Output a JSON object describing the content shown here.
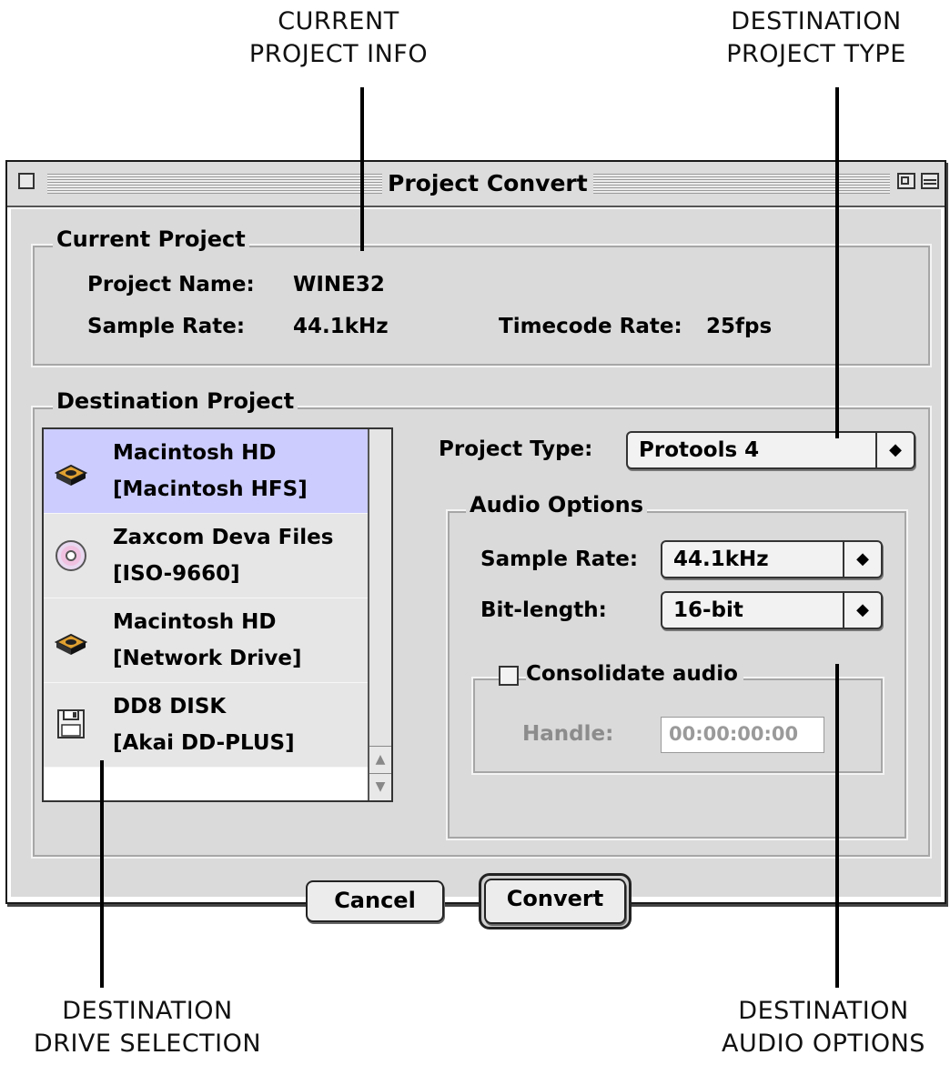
{
  "callouts": {
    "current_project_info": [
      "CURRENT",
      "PROJECT INFO"
    ],
    "destination_project_type": [
      "DESTINATION",
      "PROJECT TYPE"
    ],
    "destination_drive_selection": [
      "DESTINATION",
      "DRIVE SELECTION"
    ],
    "destination_audio_options": [
      "DESTINATION",
      "AUDIO OPTIONS"
    ]
  },
  "window": {
    "title": "Project Convert"
  },
  "current_project": {
    "group_title": "Current Project",
    "project_name_label": "Project Name:",
    "project_name_value": "WINE32",
    "sample_rate_label": "Sample Rate:",
    "sample_rate_value": "44.1kHz",
    "timecode_rate_label": "Timecode Rate:",
    "timecode_rate_value": "25fps"
  },
  "destination_project": {
    "group_title": "Destination Project",
    "drives": [
      {
        "name": "Macintosh HD",
        "format": "[Macintosh HFS]",
        "icon": "hard-drive-icon",
        "selected": true
      },
      {
        "name": "Zaxcom Deva Files",
        "format": "[ISO-9660]",
        "icon": "cd-disc-icon",
        "selected": false
      },
      {
        "name": "Macintosh HD",
        "format": "[Network Drive]",
        "icon": "hard-drive-icon",
        "selected": false
      },
      {
        "name": "DD8 DISK",
        "format": "[Akai DD-PLUS]",
        "icon": "floppy-disk-icon",
        "selected": false
      }
    ],
    "project_type_label": "Project Type:",
    "project_type_value": "Protools 4",
    "audio_options": {
      "group_title": "Audio Options",
      "sample_rate_label": "Sample Rate:",
      "sample_rate_value": "44.1kHz",
      "bit_length_label": "Bit-length:",
      "bit_length_value": "16-bit",
      "consolidate_label": "Consolidate audio",
      "consolidate_checked": false,
      "handle_label": "Handle:",
      "handle_value": "00:00:00:00"
    }
  },
  "buttons": {
    "cancel": "Cancel",
    "convert": "Convert"
  },
  "colors": {
    "selection": "#ccccff",
    "window_bg": "#dadada"
  }
}
